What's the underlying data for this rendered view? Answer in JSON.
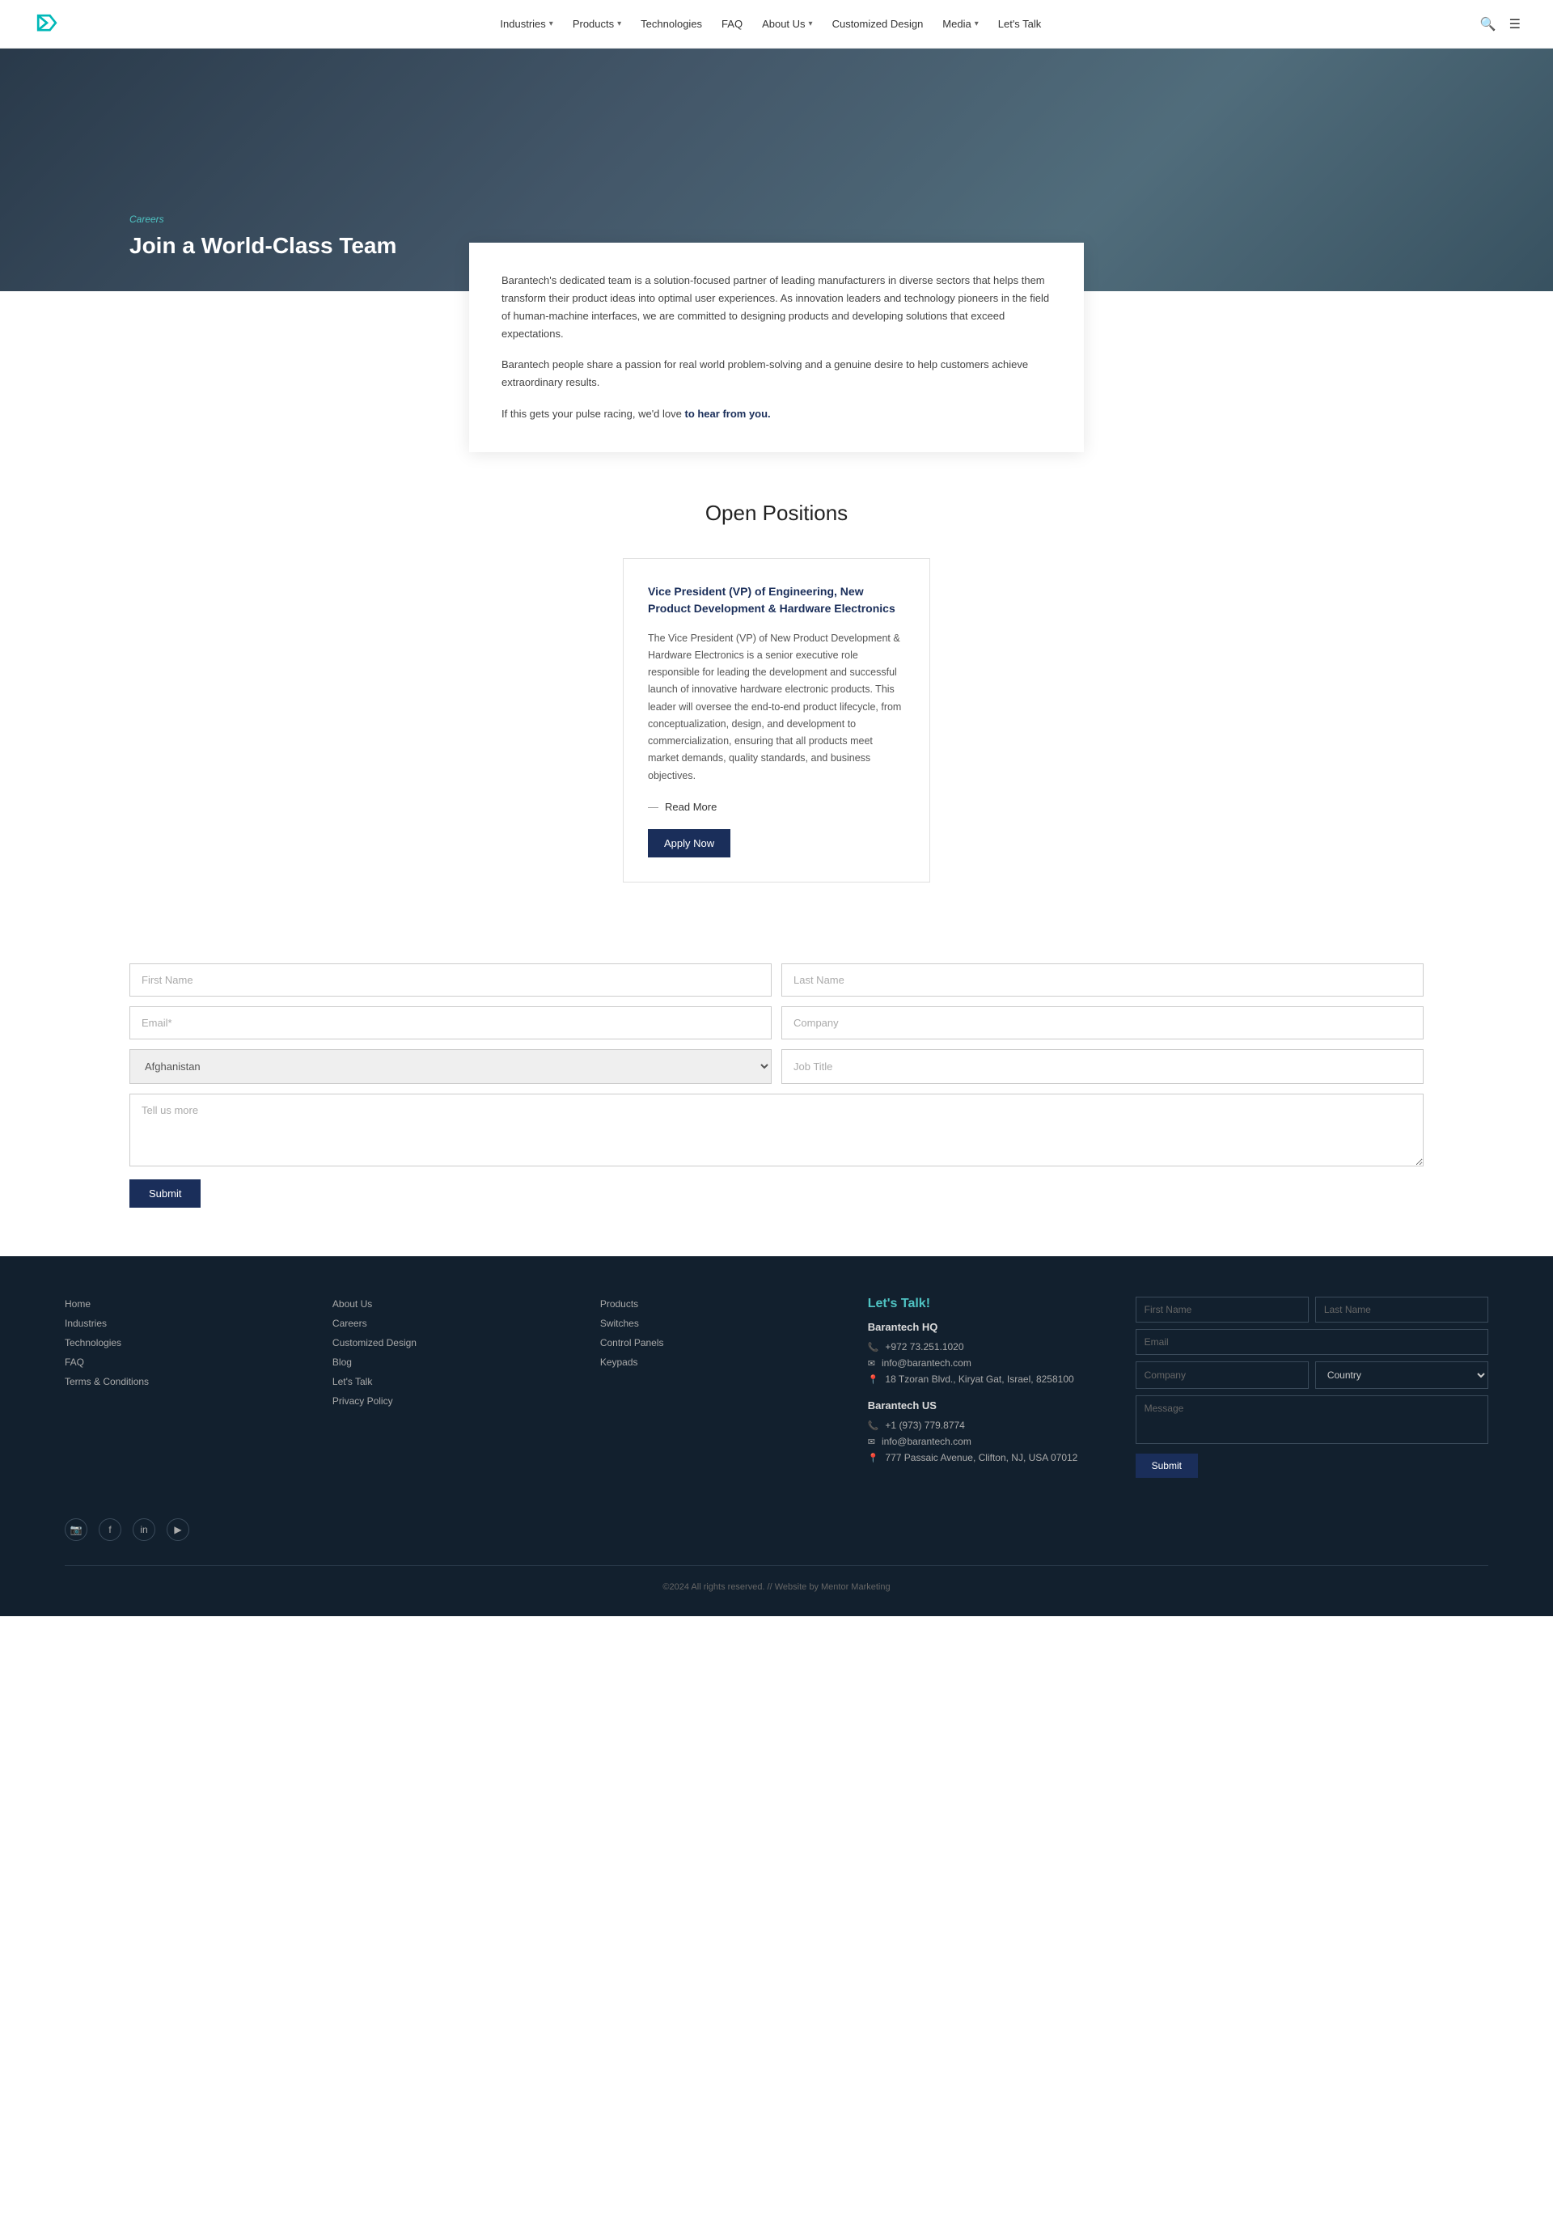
{
  "navbar": {
    "logo_alt": "Barantech Logo",
    "links": [
      {
        "label": "Industries",
        "has_dropdown": true
      },
      {
        "label": "Products",
        "has_dropdown": true
      },
      {
        "label": "Technologies",
        "has_dropdown": false
      },
      {
        "label": "FAQ",
        "has_dropdown": false
      },
      {
        "label": "About Us",
        "has_dropdown": true
      },
      {
        "label": "Customized Design",
        "has_dropdown": false
      },
      {
        "label": "Media",
        "has_dropdown": true
      },
      {
        "label": "Let's Talk",
        "has_dropdown": false
      }
    ]
  },
  "hero": {
    "breadcrumb": "Careers",
    "title": "Join a World-Class Team"
  },
  "intro": {
    "para1": "Barantech's dedicated team is a solution-focused partner of leading manufacturers in diverse sectors that helps them transform their product ideas into optimal user experiences. As innovation leaders and technology pioneers in the field of human-machine interfaces, we are committed to designing products and developing solutions that exceed expectations.",
    "para2": "Barantech people share a passion for real world problem-solving and a genuine desire to help customers achieve extraordinary results.",
    "para3_prefix": "If this gets your pulse racing, we'd love ",
    "para3_link": "to hear from you.",
    "para3_suffix": ""
  },
  "open_positions": {
    "heading": "Open Positions",
    "job": {
      "title": "Vice President (VP) of Engineering, New Product Development & Hardware Electronics",
      "description": "The Vice President (VP) of New Product Development & Hardware Electronics is a senior executive role responsible for leading the development and successful launch of innovative hardware electronic products. This leader will oversee the end-to-end product lifecycle, from conceptualization, design, and development to commercialization, ensuring that all products meet market demands, quality standards, and business objectives.",
      "read_more": "Read More",
      "apply_btn": "Apply Now"
    }
  },
  "application_form": {
    "first_name_placeholder": "First Name",
    "last_name_placeholder": "Last Name",
    "email_placeholder": "Email*",
    "company_placeholder": "Company",
    "country_default": "Afghanistan",
    "job_title_placeholder": "Job Title",
    "message_placeholder": "Tell us more",
    "submit_label": "Submit"
  },
  "footer": {
    "col1_heading": "",
    "col1_links": [
      {
        "label": "Home"
      },
      {
        "label": "Industries"
      },
      {
        "label": "Technologies"
      },
      {
        "label": "FAQ"
      },
      {
        "label": "Terms & Conditions"
      }
    ],
    "col2_links": [
      {
        "label": "About Us"
      },
      {
        "label": "Careers"
      },
      {
        "label": "Customized Design"
      },
      {
        "label": "Blog"
      },
      {
        "label": "Let's Talk"
      },
      {
        "label": "Privacy Policy"
      }
    ],
    "col3_links": [
      {
        "label": "Products"
      },
      {
        "label": "Switches"
      },
      {
        "label": "Control Panels"
      },
      {
        "label": "Keypads"
      }
    ],
    "contact": {
      "heading": "Let's Talk!",
      "hq_title": "Barantech HQ",
      "hq_phone": "+972 73.251.1020",
      "hq_email": "info@barantech.com",
      "hq_address": "18 Tzoran Blvd., Kiryat Gat, Israel, 8258100",
      "us_title": "Barantech US",
      "us_phone": "+1 (973) 779.8774",
      "us_email": "info@barantech.com",
      "us_address": "777 Passaic Avenue, Clifton, NJ, USA 07012"
    },
    "contact_form": {
      "first_name_placeholder": "First Name",
      "last_name_placeholder": "Last Name",
      "email_placeholder": "Email",
      "company_placeholder": "Company",
      "country_placeholder": "Country",
      "message_placeholder": "Message",
      "submit_label": "Submit"
    },
    "social_icons": [
      {
        "name": "instagram-icon",
        "symbol": "📷"
      },
      {
        "name": "facebook-icon",
        "symbol": "f"
      },
      {
        "name": "linkedin-icon",
        "symbol": "in"
      },
      {
        "name": "youtube-icon",
        "symbol": "▶"
      }
    ],
    "copyright": "©2024 All rights reserved.   //   Website by Mentor Marketing"
  }
}
